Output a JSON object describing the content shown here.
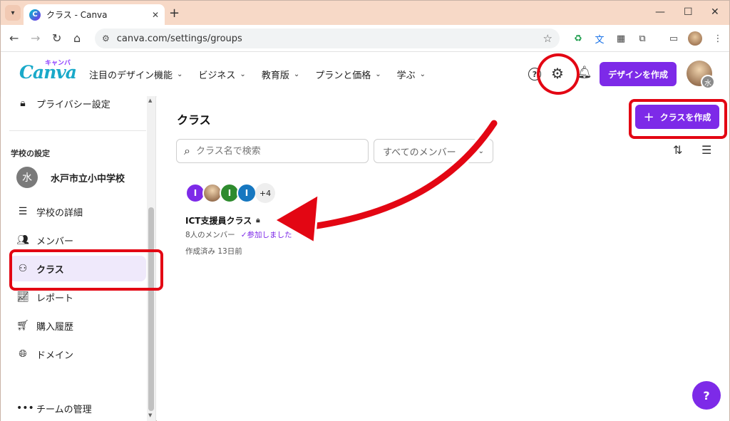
{
  "browser": {
    "tab_title": "クラス - Canva",
    "url": "canva.com/settings/groups"
  },
  "canva_header": {
    "logo": "Canva",
    "logo_kana": "キャンバ",
    "nav": [
      "注目のデザイン機能",
      "ビジネス",
      "教育版",
      "プランと価格",
      "学ぶ"
    ],
    "create_design": "デザインを作成",
    "avatar_badge": "水"
  },
  "sidebar": {
    "privacy": "プライバシー設定",
    "section_title": "学校の設定",
    "school_initial": "水",
    "school_name": "水戸市立小中学校",
    "items": [
      {
        "label": "学校の詳細",
        "icon": "list-icon"
      },
      {
        "label": "メンバー",
        "icon": "members-icon"
      },
      {
        "label": "クラス",
        "icon": "groups-icon"
      },
      {
        "label": "レポート",
        "icon": "chart-icon"
      },
      {
        "label": "購入履歴",
        "icon": "cart-icon"
      },
      {
        "label": "ドメイン",
        "icon": "globe-icon"
      }
    ],
    "team_manage": "チームの管理"
  },
  "main": {
    "title": "クラス",
    "create_class": "クラスを作成",
    "search_placeholder": "クラス名で検索",
    "filter_value": "すべてのメンバー",
    "class_card": {
      "avatars": [
        "I",
        "",
        "I",
        "I"
      ],
      "more_count": "+4",
      "name": "ICT支援員クラス",
      "members": "8人のメンバー",
      "joined": "✓参加しました",
      "created": "作成済み 13日前"
    },
    "help": "?"
  },
  "colors": {
    "accent": "#7d2ae8",
    "annotation": "#e30613"
  }
}
